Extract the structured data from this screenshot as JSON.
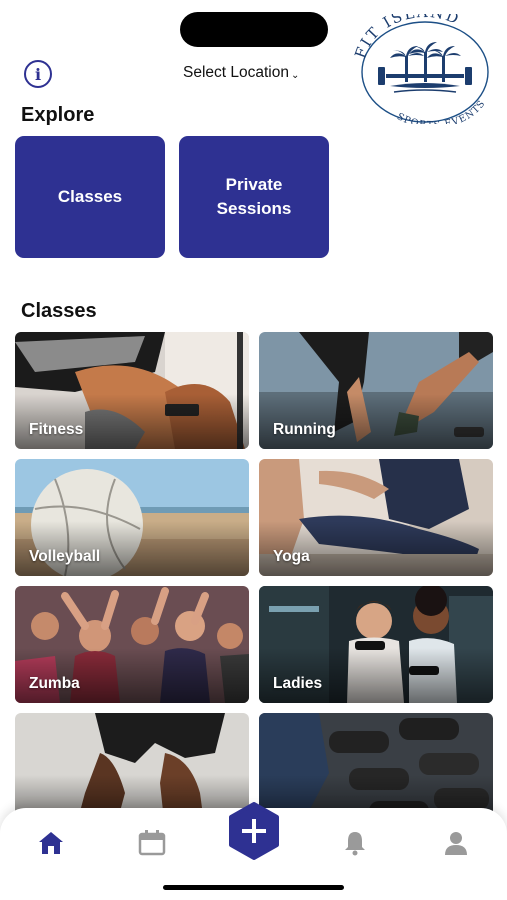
{
  "header": {
    "location_label": "Select Location",
    "location_chevron": "⌄",
    "info_glyph": "i",
    "logo": {
      "top_text": "FIT ISLAND",
      "bottom_text": "SPORTS EVENTS"
    }
  },
  "explore": {
    "title": "Explore",
    "cards": [
      {
        "label": "Classes"
      },
      {
        "label": "Private Sessions"
      }
    ]
  },
  "classes": {
    "title": "Classes",
    "tiles": [
      {
        "label": "Fitness"
      },
      {
        "label": "Running"
      },
      {
        "label": "Volleyball"
      },
      {
        "label": "Yoga"
      },
      {
        "label": "Zumba"
      },
      {
        "label": "Ladies"
      },
      {
        "label": ""
      },
      {
        "label": ""
      }
    ]
  },
  "tabbar": {
    "tabs": [
      {
        "icon": "home-icon",
        "active": true
      },
      {
        "icon": "calendar-icon",
        "active": false
      },
      {
        "icon": "add-icon",
        "active": false
      },
      {
        "icon": "bell-icon",
        "active": false
      },
      {
        "icon": "profile-icon",
        "active": false
      }
    ]
  },
  "colors": {
    "brand": "#2e3192",
    "inactive_icon": "#9a9a9a"
  }
}
